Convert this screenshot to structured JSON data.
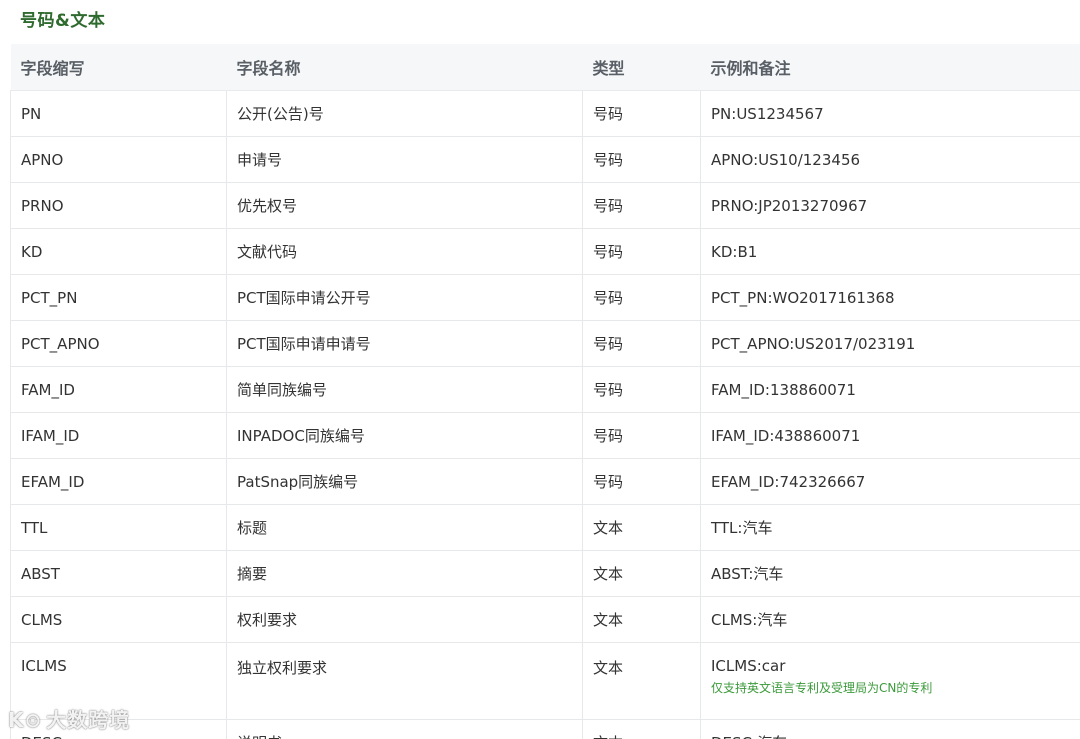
{
  "section_title": "号码&文本",
  "table": {
    "headers": [
      "字段缩写",
      "字段名称",
      "类型",
      "示例和备注"
    ],
    "rows": [
      {
        "abbr": "PN",
        "name": "公开(公告)号",
        "type": "号码",
        "example": "PN:US1234567"
      },
      {
        "abbr": "APNO",
        "name": "申请号",
        "type": "号码",
        "example": "APNO:US10/123456"
      },
      {
        "abbr": "PRNO",
        "name": "优先权号",
        "type": "号码",
        "example": "PRNO:JP2013270967"
      },
      {
        "abbr": "KD",
        "name": "文献代码",
        "type": "号码",
        "example": "KD:B1"
      },
      {
        "abbr": "PCT_PN",
        "name": "PCT国际申请公开号",
        "type": "号码",
        "example": "PCT_PN:WO2017161368"
      },
      {
        "abbr": "PCT_APNO",
        "name": "PCT国际申请申请号",
        "type": "号码",
        "example": "PCT_APNO:US2017/023191"
      },
      {
        "abbr": "FAM_ID",
        "name": "简单同族编号",
        "type": "号码",
        "example": "FAM_ID:138860071"
      },
      {
        "abbr": "IFAM_ID",
        "name": "INPADOC同族编号",
        "type": "号码",
        "example": "IFAM_ID:438860071"
      },
      {
        "abbr": "EFAM_ID",
        "name": "PatSnap同族编号",
        "type": "号码",
        "example": "EFAM_ID:742326667"
      },
      {
        "abbr": "TTL",
        "name": "标题",
        "type": "文本",
        "example": "TTL:汽车"
      },
      {
        "abbr": "ABST",
        "name": "摘要",
        "type": "文本",
        "example": "ABST:汽车"
      },
      {
        "abbr": "CLMS",
        "name": "权利要求",
        "type": "文本",
        "example": "CLMS:汽车"
      },
      {
        "abbr": "ICLMS",
        "name": "独立权利要求",
        "type": "文本",
        "example": "ICLMS:car",
        "note": "仅支持英文语言专利及受理局为CN的专利"
      },
      {
        "abbr": "DESC",
        "name": "说明书",
        "type": "文本",
        "example": "DESC:汽车"
      }
    ]
  },
  "watermark": {
    "logo": "K⊙",
    "text": "大数跨境"
  },
  "colors": {
    "title": "#2f6b2f",
    "header_bg": "#f6f7f8",
    "note": "#3a9a3a",
    "border": "#e6e8ea"
  }
}
